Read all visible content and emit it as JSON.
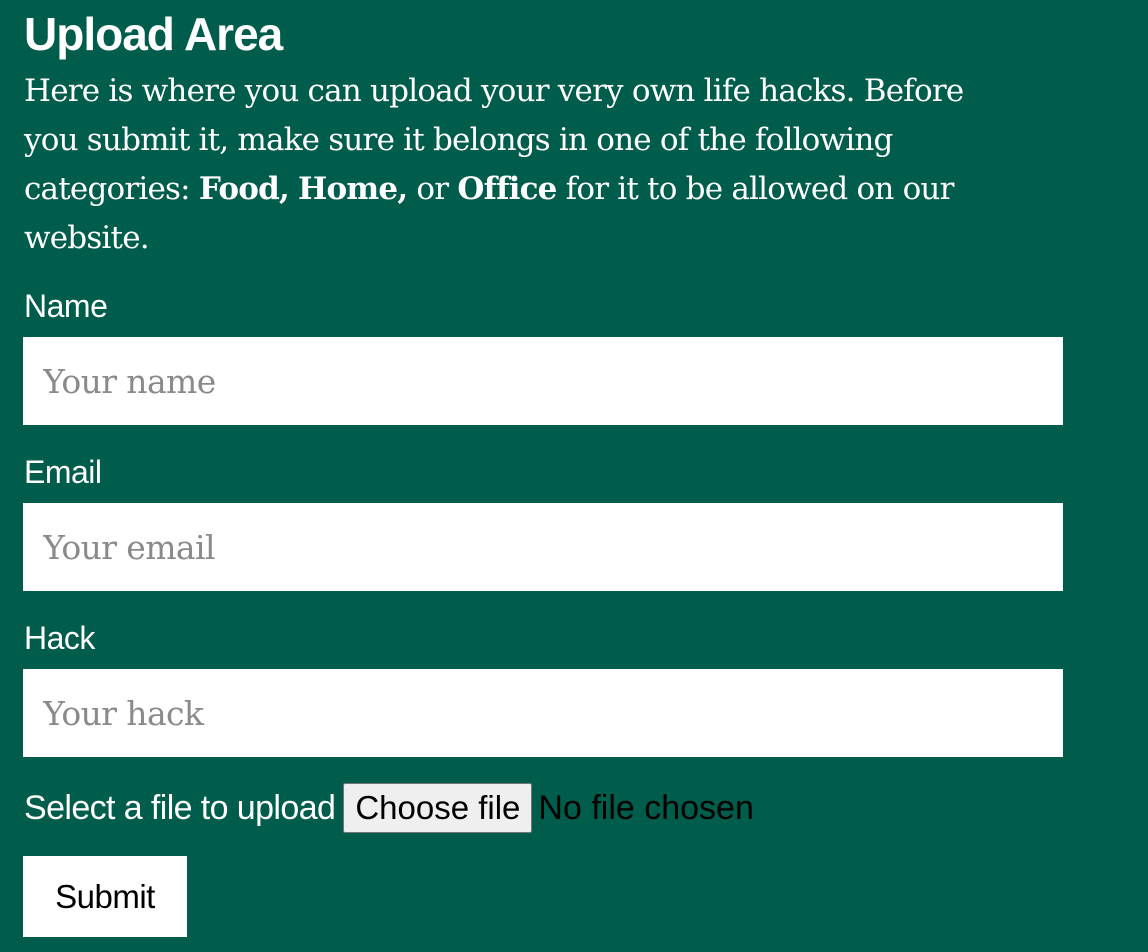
{
  "page": {
    "title": "Upload Area",
    "intro": {
      "text_1": "Here is where you can upload your very own life hacks. Before you submit it, make sure it belongs in one of the following categories: ",
      "category_food": "Food,",
      "category_home": "Home,",
      "text_or": "or",
      "category_office": "Office",
      "text_2": "for it to be allowed on our website."
    }
  },
  "form": {
    "name": {
      "label": "Name",
      "placeholder": "Your name",
      "value": ""
    },
    "email": {
      "label": "Email",
      "placeholder": "Your email",
      "value": ""
    },
    "hack": {
      "label": "Hack",
      "placeholder": "Your hack",
      "value": ""
    },
    "file": {
      "label": "Select a file to upload",
      "button_label": "Choose file",
      "status": "No file chosen"
    },
    "submit_label": "Submit"
  },
  "colors": {
    "background": "#005c4b",
    "text": "#ffffff",
    "input_background": "#ffffff",
    "placeholder": "#8a8a8a"
  }
}
